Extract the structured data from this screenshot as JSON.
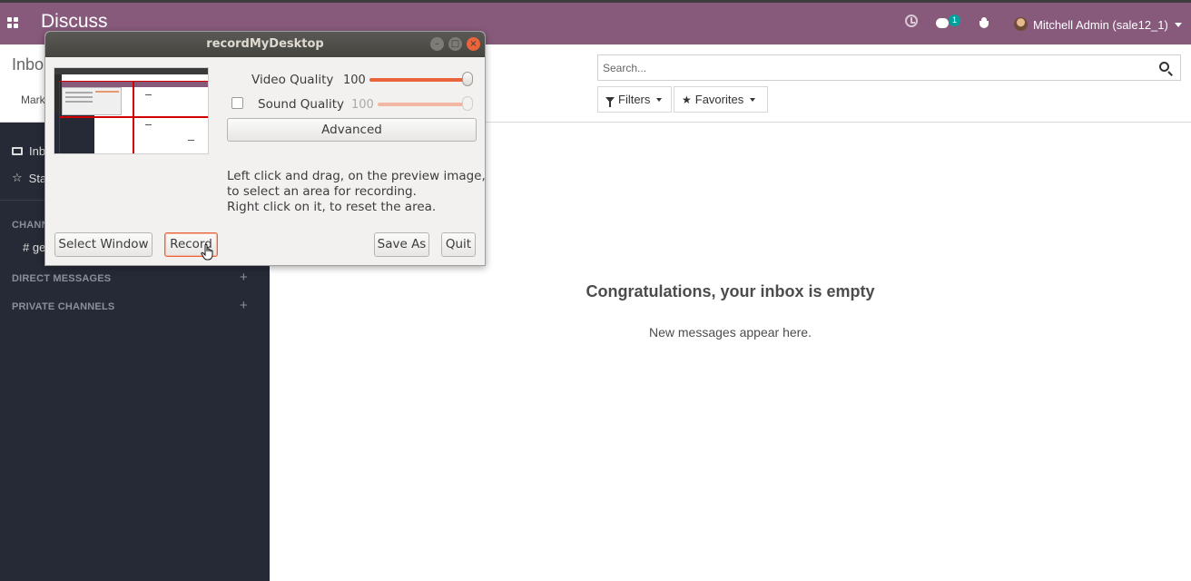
{
  "navbar": {
    "app_title": "Discuss",
    "chat_badge": "1",
    "user_name": "Mitchell Admin (sale12_1)",
    "accent": "#875a7b",
    "icons": [
      "apps-icon",
      "clock-icon",
      "chat-icon",
      "bug-icon",
      "avatar"
    ]
  },
  "control_panel": {
    "title": "Inbo",
    "mark_all_label": "Mark",
    "search_placeholder": "Search...",
    "filters_label": "Filters",
    "favorites_label": "Favorites"
  },
  "sidebar": {
    "items": [
      {
        "label": "Inb",
        "icon": "inbox-icon"
      },
      {
        "label": "Sta",
        "icon": "star-icon"
      }
    ],
    "channels_header": "CHANN",
    "channel_item": "# ge",
    "direct_messages_header": "DIRECT MESSAGES",
    "private_channels_header": "PRIVATE CHANNELS",
    "add_glyph": "+"
  },
  "main": {
    "empty_title": "Congratulations, your inbox is empty",
    "empty_subtitle": "New messages appear here."
  },
  "recorder": {
    "window_title": "recordMyDesktop",
    "video_quality_label": "Video Quality",
    "video_quality_value": "100",
    "video_quality_level": 1.0,
    "sound_quality_label": "Sound Quality",
    "sound_quality_value": "100",
    "sound_quality_level": 1.0,
    "sound_enabled": false,
    "advanced_label": "Advanced",
    "help_text": "Left click and drag, on the preview image,\nto select an area for recording.\nRight click on it, to reset the area.",
    "select_window_label": "Select Window",
    "record_label": "Record",
    "save_as_label": "Save As",
    "quit_label": "Quit",
    "window_buttons": {
      "minimize": "–",
      "maximize": "□",
      "close": "×"
    },
    "accent": "#e9643a"
  }
}
